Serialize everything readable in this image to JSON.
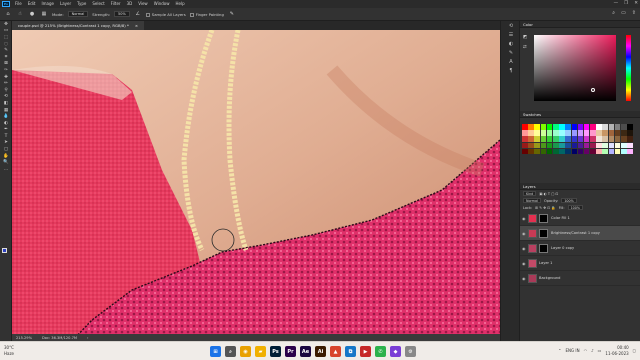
{
  "app": {
    "logo_text": "Ps"
  },
  "menubar": {
    "items": [
      "File",
      "Edit",
      "Image",
      "Layer",
      "Type",
      "Select",
      "Filter",
      "3D",
      "View",
      "Window",
      "Help"
    ],
    "window_controls": [
      "—",
      "❐",
      "✕"
    ]
  },
  "optionsbar": {
    "mode_label": "Mode:",
    "mode_value": "Normal",
    "strength_label": "Strength:",
    "strength_value": "50%",
    "sample_all_layers": "Sample All Layers",
    "finger_painting": "Finger Painting",
    "right_icons": [
      "search-icon",
      "workspace-icon",
      "share-icon"
    ]
  },
  "document_tab": {
    "title": "couple.psd @ 215% (Brightness/Contrast 1 copy, RGB/8) *",
    "close": "×"
  },
  "statusbar": {
    "zoom": "215.29%",
    "doc_info": "Doc: 36.3M/120.7M",
    "arrow": "›"
  },
  "toolbar": {
    "tools": [
      "move-tool-icon",
      "artboard-icon",
      "marquee-tool-icon",
      "lasso-tool-icon",
      "quick-select-icon",
      "crop-tool-icon",
      "frame-tool-icon",
      "eyedropper-icon",
      "healing-brush-icon",
      "brush-tool-icon",
      "clone-stamp-icon",
      "history-brush-icon",
      "eraser-icon",
      "gradient-tool-icon",
      "blur-tool-icon",
      "dodge-tool-icon",
      "pen-tool-icon",
      "type-tool-icon",
      "path-select-icon",
      "rectangle-tool-icon",
      "hand-tool-icon",
      "zoom-tool-icon",
      "more-tools-icon"
    ],
    "glyphs": [
      "✥",
      "▭",
      "⬚",
      "◌",
      "✎",
      "⌗",
      "⊠",
      "✑",
      "✚",
      "✏",
      "⚲",
      "⟲",
      "◧",
      "▦",
      "💧",
      "◐",
      "✒",
      "T",
      "➤",
      "▢",
      "✋",
      "🔍",
      "…"
    ],
    "foreground_color": "#2b3fbf",
    "background_color": "#f2f2f2"
  },
  "panels": {
    "color_tab": "Color",
    "swatches_tab": "Swatches",
    "layers_tab": "Layers",
    "kind_label": "Kind",
    "blend_mode": "Normal",
    "opacity_label": "Opacity:",
    "opacity_value": "100%",
    "lock_label": "Lock:",
    "fill_label": "Fill:",
    "fill_value": "100%",
    "color_accent": "#ec1c5b"
  },
  "swatches": [
    "#ff0000",
    "#ff8000",
    "#ffff00",
    "#80ff00",
    "#00ff00",
    "#00ff80",
    "#00ffff",
    "#0080ff",
    "#0000ff",
    "#8000ff",
    "#ff00ff",
    "#ff0080",
    "#ffffff",
    "#d9d9d9",
    "#b3b3b3",
    "#808080",
    "#4d4d4d",
    "#000000",
    "#ff9999",
    "#ffcc99",
    "#ffff99",
    "#ccff99",
    "#99ff99",
    "#99ffcc",
    "#99ffff",
    "#99ccff",
    "#9999ff",
    "#cc99ff",
    "#ff99ff",
    "#ff99cc",
    "#e6c8a0",
    "#c89664",
    "#a0643c",
    "#643c1e",
    "#3c2814",
    "#1e140a",
    "#cc3333",
    "#cc6633",
    "#cccc33",
    "#66cc33",
    "#33cc33",
    "#33cc66",
    "#33cccc",
    "#3366cc",
    "#3333cc",
    "#6633cc",
    "#cc33cc",
    "#cc3366",
    "#f2e6d9",
    "#d9c2a6",
    "#b38c66",
    "#8c6640",
    "#664020",
    "#402010",
    "#991a1a",
    "#994d1a",
    "#99991a",
    "#4d991a",
    "#1a991a",
    "#1a994d",
    "#1a9999",
    "#1a4d99",
    "#1a1a99",
    "#4d1a99",
    "#991a99",
    "#991a4d",
    "#ffe0e0",
    "#e0ffe0",
    "#e0e0ff",
    "#fffde0",
    "#e0ffff",
    "#ffe0ff",
    "#660000",
    "#663300",
    "#666600",
    "#336600",
    "#006600",
    "#006633",
    "#006666",
    "#003366",
    "#000066",
    "#330066",
    "#660066",
    "#660033",
    "#ffb3b3",
    "#b3ffb3",
    "#b3b3ff",
    "#ffffb3",
    "#b3ffff",
    "#ffb3ff"
  ],
  "layers": [
    {
      "name": "Color Fill 1",
      "thumb": "#e33050",
      "mask": true,
      "visible": true,
      "selected": false
    },
    {
      "name": "Brightness/Contrast 1 copy",
      "thumb": "#c83a55",
      "mask": true,
      "visible": true,
      "selected": true
    },
    {
      "name": "Layer 0 copy",
      "thumb": "#b84060",
      "mask": true,
      "visible": true,
      "selected": false
    },
    {
      "name": "Layer 1",
      "thumb": "#c24a68",
      "mask": false,
      "visible": true,
      "selected": false
    },
    {
      "name": "Background",
      "thumb": "#a83a58",
      "mask": false,
      "visible": true,
      "selected": false
    }
  ],
  "taskbar": {
    "weather_temp": "30°C",
    "weather_desc": "Haze",
    "apps": [
      {
        "name": "start-icon",
        "glyph": "⊞",
        "color": "#1a73e8"
      },
      {
        "name": "search-icon",
        "glyph": "⌕",
        "color": "#555555"
      },
      {
        "name": "chrome-icon",
        "glyph": "◉",
        "color": "#e8a000"
      },
      {
        "name": "explorer-icon",
        "glyph": "▰",
        "color": "#f0b000"
      },
      {
        "name": "photoshop-icon",
        "glyph": "Ps",
        "color": "#001e36"
      },
      {
        "name": "premiere-icon",
        "glyph": "Pr",
        "color": "#2a004a"
      },
      {
        "name": "after-effects-icon",
        "glyph": "Ae",
        "color": "#1a0640"
      },
      {
        "name": "illustrator-icon",
        "glyph": "Ai",
        "color": "#3a1a00"
      },
      {
        "name": "brave-icon",
        "glyph": "▲",
        "color": "#d8442c"
      },
      {
        "name": "vscode-icon",
        "glyph": "⧉",
        "color": "#1677c8"
      },
      {
        "name": "media-icon",
        "glyph": "▶",
        "color": "#c62828"
      },
      {
        "name": "whatsapp-icon",
        "glyph": "✆",
        "color": "#2bb24c"
      },
      {
        "name": "store-icon",
        "glyph": "◆",
        "color": "#7a3ed6"
      },
      {
        "name": "settings-icon",
        "glyph": "⚙",
        "color": "#888888"
      }
    ],
    "lang": "ENG",
    "region": "IN",
    "time": "00:40",
    "date": "11-06-2023"
  }
}
